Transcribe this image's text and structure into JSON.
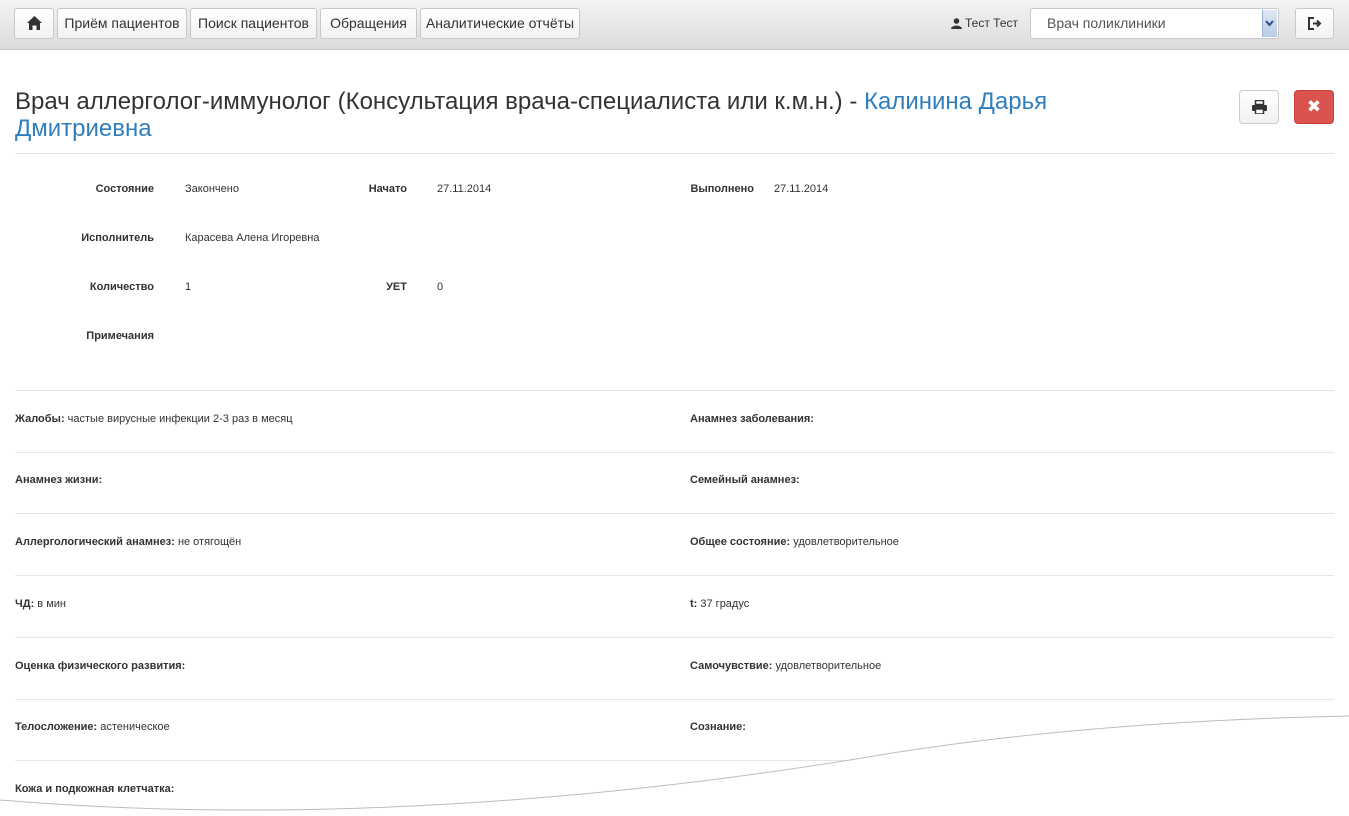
{
  "navbar": {
    "nav_items": [
      "Приём пациентов",
      "Поиск пациентов",
      "Обращения",
      "Аналитические отчёты"
    ],
    "user_name": "Тест Тест",
    "role_select_value": "Врач поликлиники"
  },
  "header": {
    "title_prefix": "Врач аллерголог-иммунолог (Консультация врача-специалиста или к.м.н.) -",
    "patient_name": "Калинина Дарья Дмитриевна"
  },
  "summary": {
    "status_label": "Состояние",
    "status_value": "Закончено",
    "started_label": "Начато",
    "started_value": "27.11.2014",
    "completed_label": "Выполнено",
    "completed_value": "27.11.2014",
    "executor_label": "Исполнитель",
    "executor_value": "Карасева Алена Игоревна",
    "quantity_label": "Количество",
    "quantity_value": "1",
    "uet_label": "УЕТ",
    "uet_value": "0",
    "notes_label": "Примечания",
    "notes_value": ""
  },
  "fields": [
    {
      "label": "Жалобы:",
      "value": "частые вирусные инфекции 2-3 раз в месяц"
    },
    {
      "label": "Анамнез заболевания:",
      "value": ""
    },
    {
      "label": "Анамнез жизни:",
      "value": ""
    },
    {
      "label": "Семейный анамнез:",
      "value": ""
    },
    {
      "label": "Аллергологический анамнез:",
      "value": "не отягощён"
    },
    {
      "label": "Общее состояние:",
      "value": "удовлетворительное"
    },
    {
      "label": "ЧД:",
      "value": "в мин"
    },
    {
      "label": "t:",
      "value": "37 градус"
    },
    {
      "label": "Оценка физического развития:",
      "value": ""
    },
    {
      "label": "Самочувствие:",
      "value": "удовлетворительное"
    },
    {
      "label": "Телосложение:",
      "value": "астеническое"
    },
    {
      "label": "Сознание:",
      "value": ""
    },
    {
      "label": "Кожа и подкожная клетчатка:",
      "value": ""
    }
  ],
  "colors": {
    "link": "#2f7fbf",
    "danger": "#d9534f"
  }
}
